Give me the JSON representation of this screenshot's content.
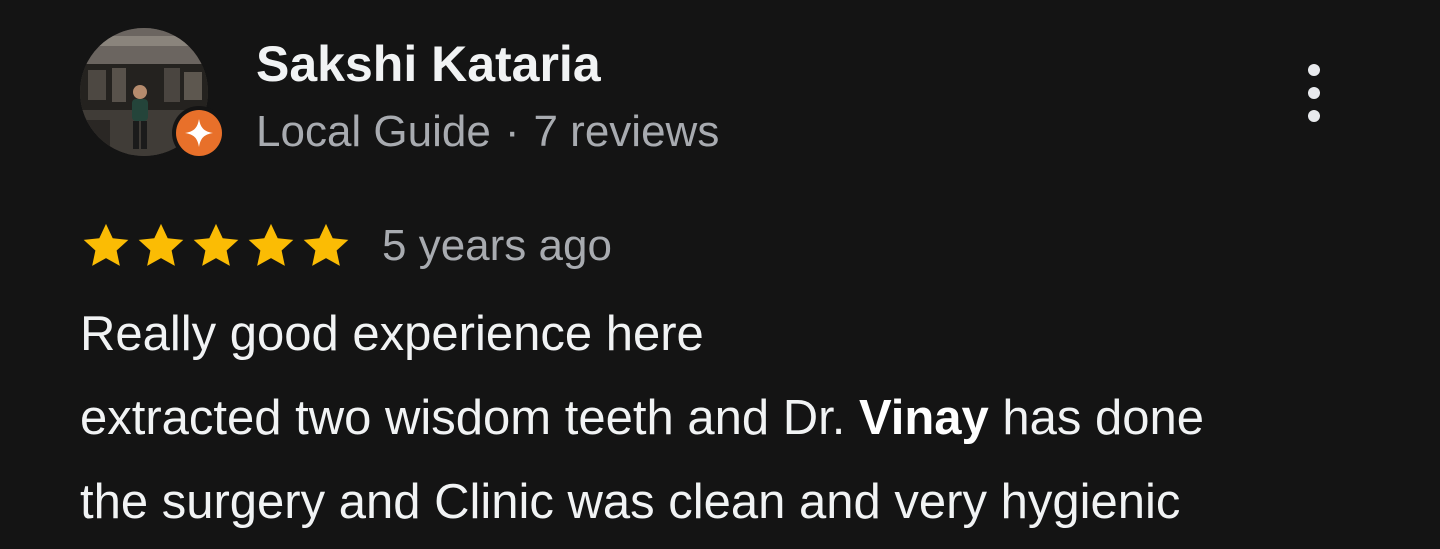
{
  "reviewer": {
    "name": "Sakshi Kataria",
    "badge": "Local Guide",
    "separator": "·",
    "review_count": "7 reviews",
    "avatar_icon": "profile-photo",
    "badge_icon": "local-guide-star-icon"
  },
  "more_options": {
    "icon": "more-vertical-icon"
  },
  "rating": {
    "stars": 5,
    "max": 5,
    "star_color": "#fbbc04",
    "time": "5 years ago"
  },
  "review": {
    "line1": "Really good experience here",
    "line2_pre": "extracted two wisdom teeth and Dr. ",
    "line2_bold": "Vinay",
    "line2_post": " has done",
    "line3": "the surgery and Clinic was clean and very hygienic"
  },
  "colors": {
    "background": "#141414",
    "primary_text": "#f1f3f4",
    "secondary_text": "#a8abb0",
    "badge": "#e8702a"
  }
}
